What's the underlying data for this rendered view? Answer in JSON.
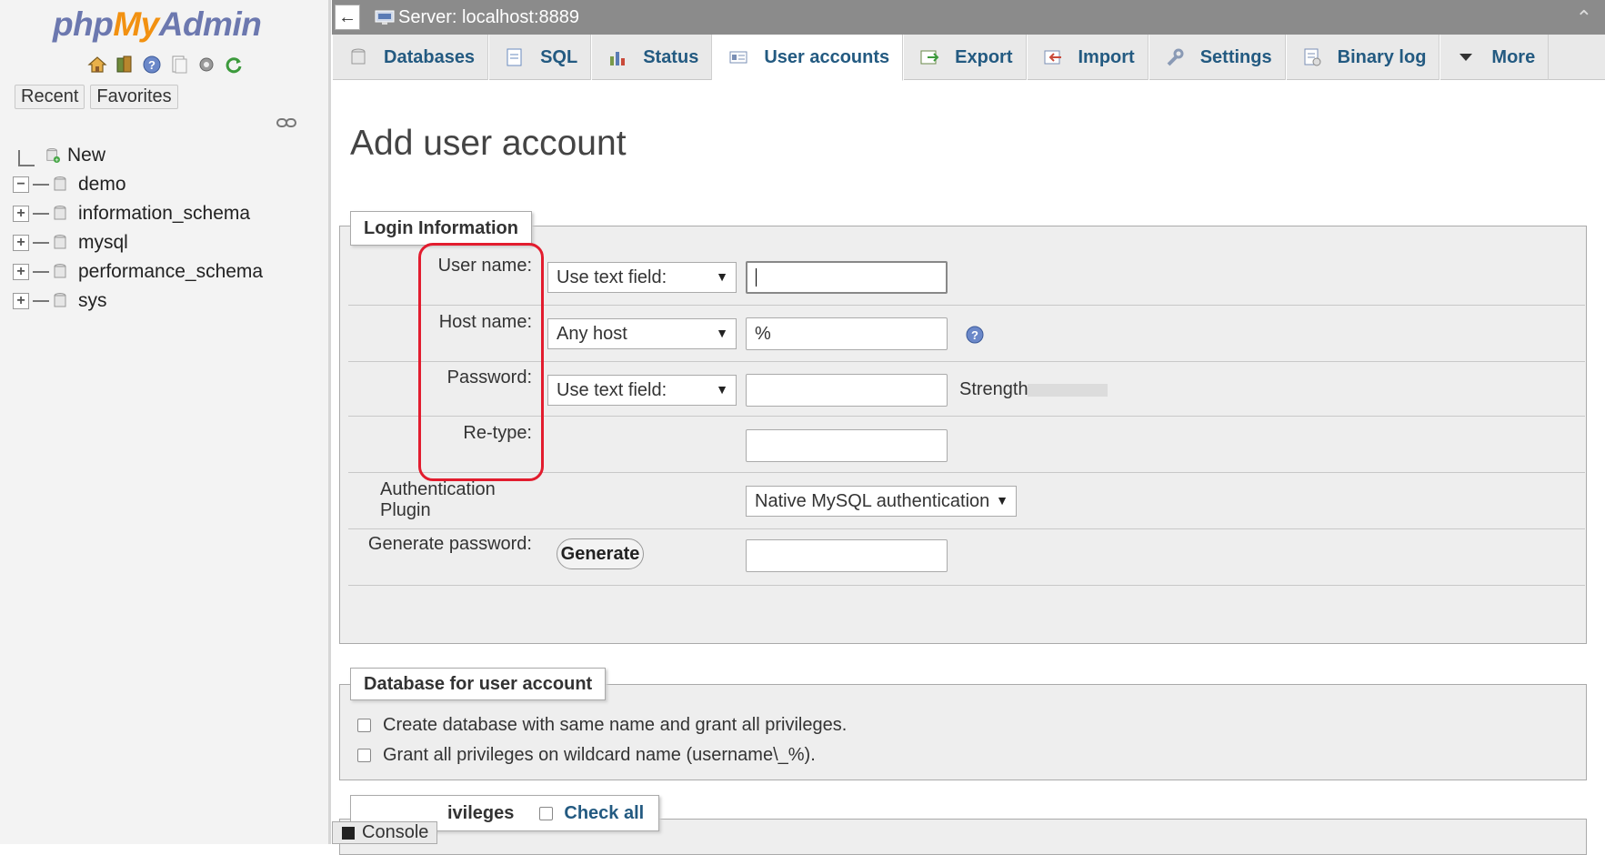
{
  "logo": {
    "php": "php",
    "my": "My",
    "admin": "Admin"
  },
  "sidebar": {
    "recent_label": "Recent",
    "favorites_label": "Favorites",
    "quick_icons": [
      "home-icon",
      "logout-icon",
      "help-icon",
      "docs-icon",
      "settings-icon",
      "reload-icon"
    ],
    "tree": [
      {
        "label": "New",
        "expander": ""
      },
      {
        "label": "demo",
        "expander": "−"
      },
      {
        "label": "information_schema",
        "expander": "+"
      },
      {
        "label": "mysql",
        "expander": "+"
      },
      {
        "label": "performance_schema",
        "expander": "+"
      },
      {
        "label": "sys",
        "expander": "+"
      }
    ]
  },
  "topbar": {
    "back": "←",
    "server": "Server: localhost:8889"
  },
  "tabs": [
    {
      "label": "Databases",
      "icon": "database-icon"
    },
    {
      "label": "SQL",
      "icon": "sql-icon"
    },
    {
      "label": "Status",
      "icon": "status-icon"
    },
    {
      "label": "User accounts",
      "icon": "users-icon"
    },
    {
      "label": "Export",
      "icon": "export-icon"
    },
    {
      "label": "Import",
      "icon": "import-icon"
    },
    {
      "label": "Settings",
      "icon": "wrench-icon"
    },
    {
      "label": "Binary log",
      "icon": "binlog-icon"
    },
    {
      "label": "More",
      "icon": "caret-down-icon"
    }
  ],
  "active_tab": "User accounts",
  "page_title": "Add user account",
  "login": {
    "legend": "Login Information",
    "user_name_label": "User name:",
    "user_name_select": "Use text field:",
    "user_name_value": "",
    "host_name_label": "Host name:",
    "host_name_select": "Any host",
    "host_name_value": "%",
    "password_label": "Password:",
    "password_select": "Use text field:",
    "password_value": "",
    "strength_label": "Strength:",
    "retype_label": "Re-type:",
    "retype_value": "",
    "auth_plugin_label": "Authentication Plugin",
    "auth_plugin_value": "Native MySQL authentication",
    "generate_label": "Generate password:",
    "generate_button": "Generate",
    "generated_value": ""
  },
  "database": {
    "legend": "Database for user account",
    "option1": "Create database with same name and grant all privileges.",
    "option2": "Grant all privileges on wildcard name (username\\_%)."
  },
  "privileges": {
    "legend_partial": "ivileges",
    "check_all": "Check all"
  },
  "console_label": "Console",
  "colors": {
    "accent": "#235a81",
    "highlight": "#e21c2e"
  }
}
